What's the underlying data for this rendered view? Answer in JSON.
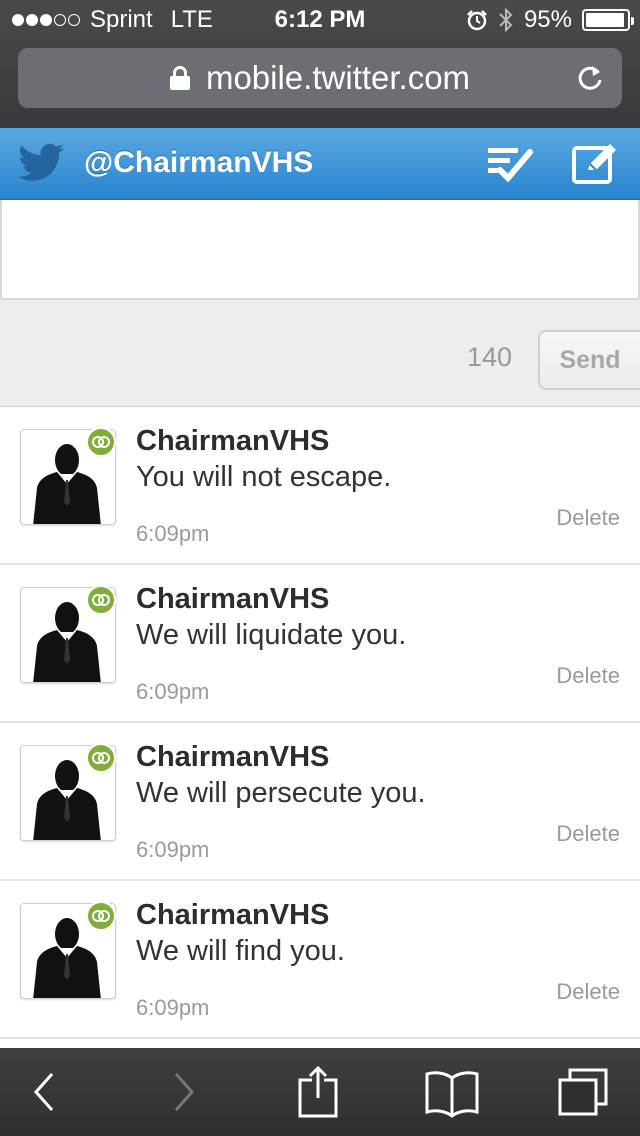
{
  "status_bar": {
    "carrier": "Sprint",
    "network": "LTE",
    "time": "6:12 PM",
    "battery": "95%",
    "battery_level": 0.95,
    "signal_bars_filled": 3,
    "signal_bars_total": 5
  },
  "browser": {
    "url": "mobile.twitter.com"
  },
  "header": {
    "handle": "@ChairmanVHS",
    "accent_color": "#2a84cf"
  },
  "compose": {
    "text": "",
    "char_count": "140",
    "send_label": "Send"
  },
  "messages": [
    {
      "name": "ChairmanVHS",
      "text": "You will not escape.",
      "time": "6:09pm",
      "delete_label": "Delete"
    },
    {
      "name": "ChairmanVHS",
      "text": "We will liquidate you.",
      "time": "6:09pm",
      "delete_label": "Delete"
    },
    {
      "name": "ChairmanVHS",
      "text": "We will persecute you.",
      "time": "6:09pm",
      "delete_label": "Delete"
    },
    {
      "name": "ChairmanVHS",
      "text": "We will find you.",
      "time": "6:09pm",
      "delete_label": "Delete"
    }
  ],
  "toolbar": {
    "icons": [
      "back-icon",
      "forward-icon",
      "share-icon",
      "bookmarks-icon",
      "tabs-icon"
    ]
  }
}
